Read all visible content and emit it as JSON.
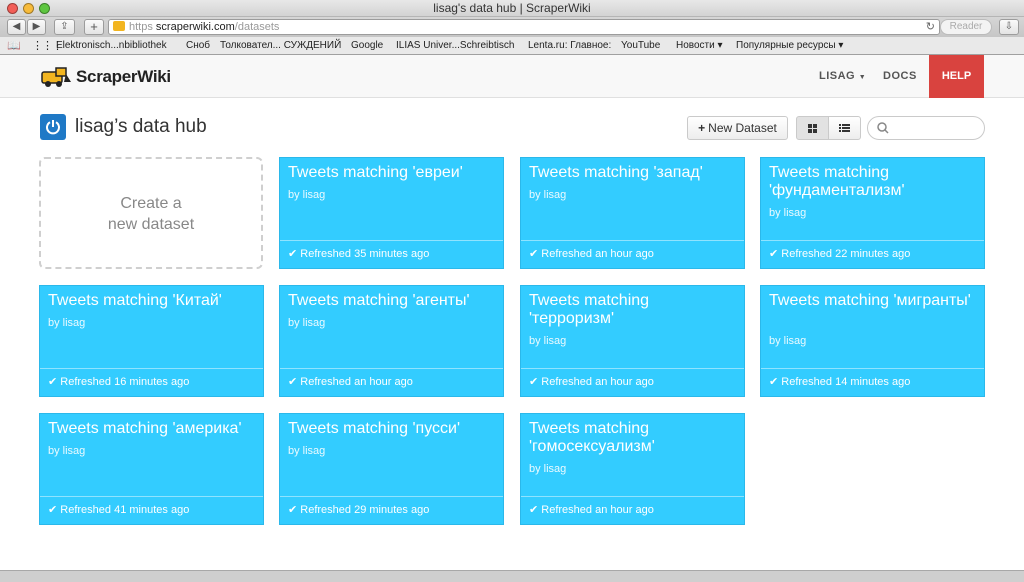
{
  "window": {
    "title": "lisag's data hub | ScraperWiki"
  },
  "browser": {
    "url_scheme": "https",
    "url_domain": "scraperwiki.com",
    "url_path": "/datasets",
    "reader_label": "Reader",
    "bookmarks": [
      "Elektronisch...nbibliothek",
      "Сноб",
      "Толковател... СУЖДЕНИЙ",
      "Google",
      "ILIAS Univer...Schreibtisch",
      "Lenta.ru: Главное:",
      "YouTube",
      "Новости ▾",
      "Популярные ресурсы ▾"
    ]
  },
  "site": {
    "logo_text": "ScraperWiki",
    "nav": {
      "user": "LISAG",
      "docs": "DOCS",
      "help": "HELP"
    }
  },
  "hub": {
    "title": "lisag’s data hub",
    "new_dataset_label": "New Dataset",
    "create_line1": "Create a",
    "create_line2": "new dataset"
  },
  "datasets": [
    {
      "title": "Tweets matching 'евреи'",
      "by": "by lisag",
      "status": "Refreshed 35 minutes ago"
    },
    {
      "title": "Tweets matching 'запад'",
      "by": "by lisag",
      "status": "Refreshed an hour ago"
    },
    {
      "title": "Tweets matching 'фундаментализм'",
      "by": "by lisag",
      "status": "Refreshed 22 minutes ago"
    },
    {
      "title": "Tweets matching 'Китай'",
      "by": "by lisag",
      "status": "Refreshed 16 minutes ago"
    },
    {
      "title": "Tweets matching 'агенты'",
      "by": "by lisag",
      "status": "Refreshed an hour ago"
    },
    {
      "title": "Tweets matching 'терроризм'",
      "by": "by lisag",
      "status": "Refreshed an hour ago"
    },
    {
      "title": "Tweets matching 'мигранты'",
      "by": "by lisag",
      "status": "Refreshed 14 minutes ago"
    },
    {
      "title": "Tweets matching 'америка'",
      "by": "by lisag",
      "status": "Refreshed 41 minutes ago"
    },
    {
      "title": "Tweets matching 'пусси'",
      "by": "by lisag",
      "status": "Refreshed 29 minutes ago"
    },
    {
      "title": "Tweets matching 'гомосексуализм'",
      "by": "by lisag",
      "status": "Refreshed an hour ago"
    }
  ],
  "colors": {
    "card": "#33ccff",
    "help": "#d9433f",
    "hub_icon": "#1f79c6"
  }
}
